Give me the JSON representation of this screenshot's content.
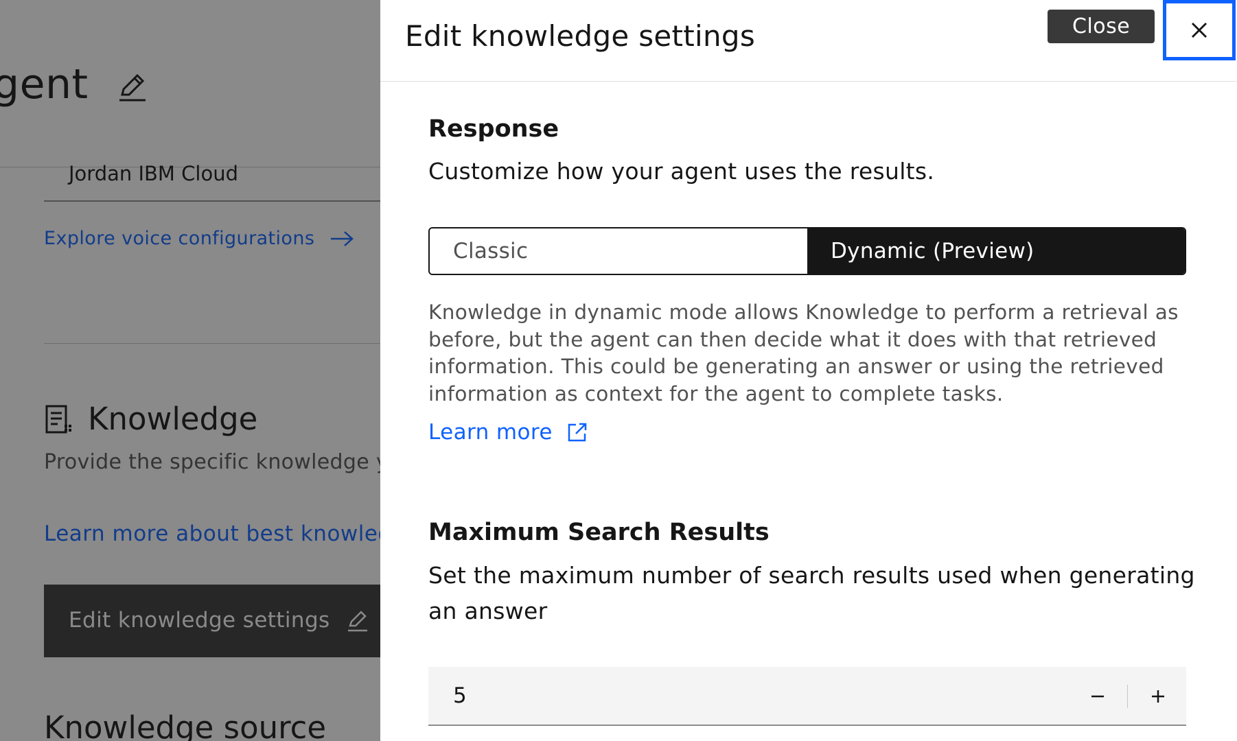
{
  "background": {
    "title": "gent",
    "field_value": "Jordan IBM Cloud",
    "voice_link": "Explore voice configurations",
    "knowledge_title": "Knowledge",
    "knowledge_desc": "Provide the specific knowledge you",
    "knowledge_link": "Learn more about best knowledge",
    "edit_button_label": "Edit knowledge settings",
    "source_title": "Knowledge source"
  },
  "panel": {
    "title": "Edit knowledge settings",
    "close_tooltip": "Close",
    "response": {
      "title": "Response",
      "description": "Customize how your agent uses the results.",
      "options": [
        "Classic",
        "Dynamic (Preview)"
      ],
      "selected": "Dynamic (Preview)",
      "helper": "Knowledge in dynamic mode allows Knowledge to perform a retrieval as before, but the agent can then decide what it does with that retrieved information. This could be generating an answer or using the retrieved information as context for the agent to complete tasks.",
      "learn_more": "Learn more"
    },
    "max_results": {
      "title": "Maximum Search Results",
      "description": "Set the maximum number of search results used when generating an answer",
      "value": "5"
    }
  },
  "colors": {
    "accent": "#0f62fe",
    "dark": "#161616",
    "overlay": "rgba(22,22,22,0.5)"
  }
}
